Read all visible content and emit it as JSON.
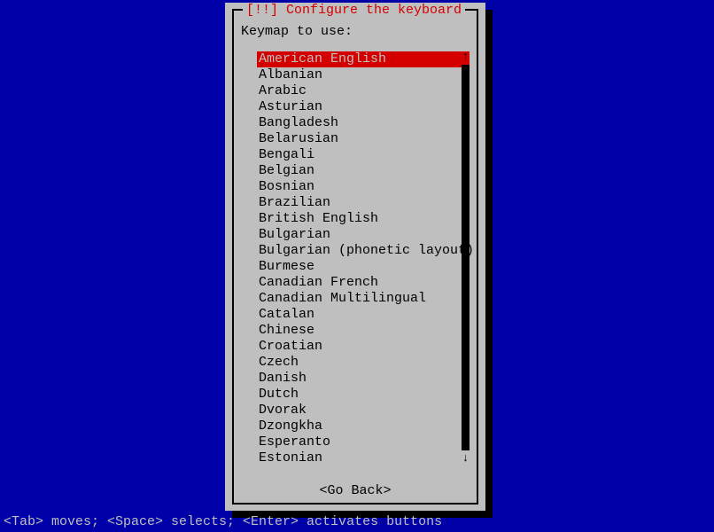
{
  "title": "[!!] Configure the keyboard",
  "prompt": "Keymap to use:",
  "items": [
    "American English",
    "Albanian",
    "Arabic",
    "Asturian",
    "Bangladesh",
    "Belarusian",
    "Bengali",
    "Belgian",
    "Bosnian",
    "Brazilian",
    "British English",
    "Bulgarian",
    "Bulgarian (phonetic layout)",
    "Burmese",
    "Canadian French",
    "Canadian Multilingual",
    "Catalan",
    "Chinese",
    "Croatian",
    "Czech",
    "Danish",
    "Dutch",
    "Dvorak",
    "Dzongkha",
    "Esperanto",
    "Estonian"
  ],
  "selected_index": 0,
  "go_back": "<Go Back>",
  "status": "<Tab> moves; <Space> selects; <Enter> activates buttons",
  "scroll": {
    "up": "↑",
    "down": "↓"
  }
}
